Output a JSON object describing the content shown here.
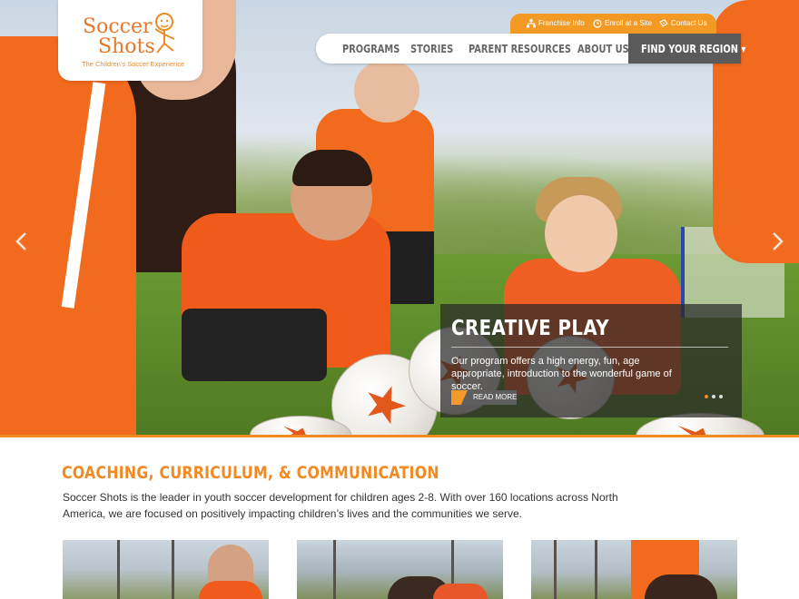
{
  "logo": {
    "word1": "Soccer",
    "word2": "Shots",
    "tagline": "The Children's Soccer Experience"
  },
  "utility_nav": [
    {
      "label": "Franchise Info",
      "icon": "org-chart-icon"
    },
    {
      "label": "Enroll at a Site",
      "icon": "clock-icon"
    },
    {
      "label": "Contact Us",
      "icon": "ticket-icon"
    }
  ],
  "main_nav": {
    "items": [
      "PROGRAMS",
      "STORIES",
      "PARENT RESOURCES",
      "ABOUT US"
    ],
    "region": "FIND YOUR REGION ▾"
  },
  "hero": {
    "title": "CREATIVE PLAY",
    "text": "Our program offers a high energy, fun, age appropriate, introduction to the wonderful game of soccer.",
    "button": "READ MORE",
    "slides": 3,
    "active_slide": 1,
    "prev_icon": "chevron-left-icon",
    "next_icon": "chevron-right-icon"
  },
  "section": {
    "headline": "COACHING, CURRICULUM, & COMMUNICATION",
    "intro": "Soccer Shots is the leader in youth soccer development for children ages 2-8. With over 160 locations across North America, we are focused on positively impacting children’s lives and the communities we serve."
  },
  "colors": {
    "accent": "#f08a24",
    "utility_bar": "#f39a24",
    "nav_region_bg": "#5a5a5a",
    "text_dark": "#333333"
  }
}
